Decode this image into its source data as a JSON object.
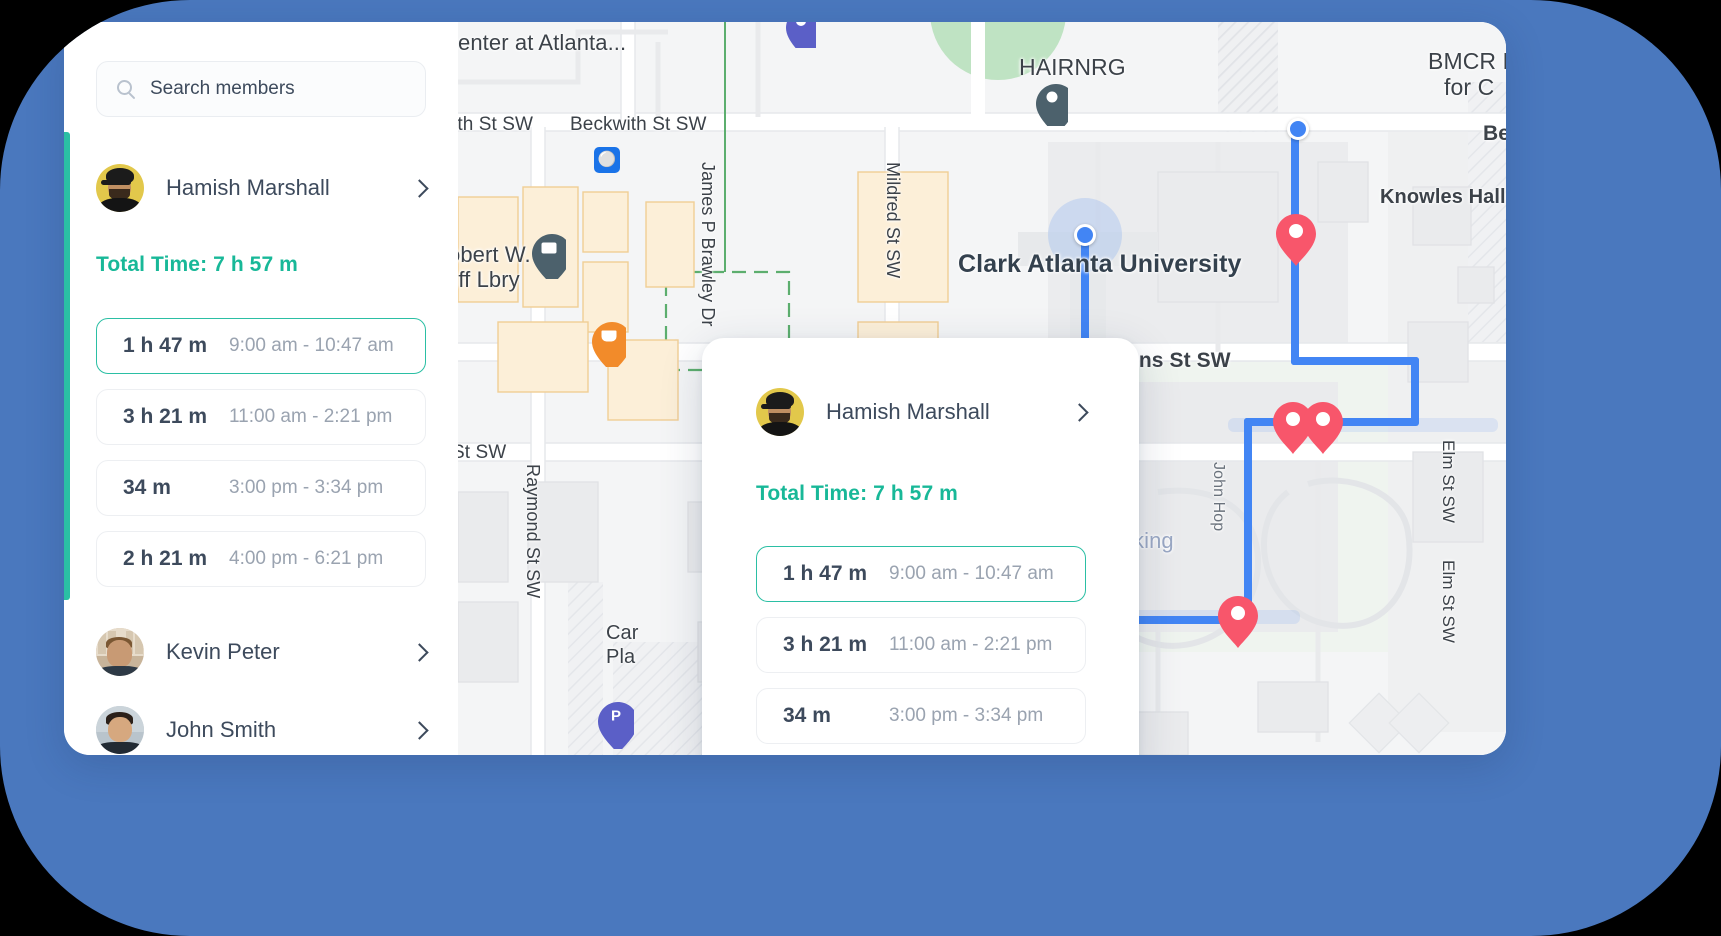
{
  "theme": {
    "frame_blue": "#4A78BE",
    "accent_teal": "#2BBFA4",
    "total_time_green": "#18B898",
    "text_dark": "#3D4A5C",
    "text_muted": "#9AA3B0",
    "route_blue": "#4285F4",
    "pin_red": "#F8566B",
    "pin_dark": "#4C616C",
    "pin_orange": "#F28B2A",
    "pin_purple": "#5B5FC7"
  },
  "search": {
    "placeholder": "Search members",
    "icon": "search-icon",
    "value": ""
  },
  "sidebar": {
    "selected_member": {
      "name": "Hamish Marshall",
      "avatar": "hamish-avatar",
      "chevron": "chevron-right-icon",
      "total_time_label": "Total Time: 7 h 57 m",
      "sessions": [
        {
          "duration": "1 h 47 m",
          "range": "9:00 am - 10:47 am",
          "selected": true
        },
        {
          "duration": "3 h 21 m",
          "range": "11:00 am - 2:21 pm",
          "selected": false
        },
        {
          "duration": "34 m",
          "range": "3:00 pm - 3:34 pm",
          "selected": false
        },
        {
          "duration": "2 h 21 m",
          "range": "4:00 pm - 6:21 pm",
          "selected": false
        }
      ]
    },
    "other_members": [
      {
        "name": "Kevin Peter",
        "avatar": "kevin-avatar",
        "chevron": "chevron-right-icon"
      },
      {
        "name": "John Smith",
        "avatar": "john-avatar",
        "chevron": "chevron-right-icon"
      }
    ]
  },
  "popup": {
    "member": {
      "name": "Hamish Marshall",
      "avatar": "hamish-avatar",
      "chevron": "chevron-right-icon"
    },
    "total_time_label": "Total Time: 7 h 57 m",
    "sessions": [
      {
        "duration": "1 h 47 m",
        "range": "9:00 am - 10:47 am",
        "selected": true
      },
      {
        "duration": "3 h 21 m",
        "range": "11:00 am - 2:21 pm",
        "selected": false
      },
      {
        "duration": "34 m",
        "range": "3:00 pm - 3:34 pm",
        "selected": false
      }
    ]
  },
  "map": {
    "labels": [
      {
        "text": "enter at Atlanta...",
        "kind": "poi"
      },
      {
        "text": "ith St SW",
        "kind": "street"
      },
      {
        "text": "Beckwith St SW",
        "kind": "street"
      },
      {
        "text": "James P Brawley Dr",
        "kind": "street-vertical"
      },
      {
        "text": "Mildred St SW",
        "kind": "street-vertical"
      },
      {
        "text": "HAIRNRG",
        "kind": "poi"
      },
      {
        "text": "BMCR B",
        "kind": "poi"
      },
      {
        "text": "for C",
        "kind": "poi"
      },
      {
        "text": "Be",
        "kind": "street"
      },
      {
        "text": "Knowles Hall",
        "kind": "poi"
      },
      {
        "text": "Clark Atlanta University",
        "kind": "place"
      },
      {
        "text": "obert W.",
        "kind": "poi"
      },
      {
        "text": "uff Lbry",
        "kind": "poi"
      },
      {
        "text": "Parsons St SW",
        "kind": "street"
      },
      {
        "text": "St SW",
        "kind": "street"
      },
      {
        "text": "Raymond St SW",
        "kind": "street-vertical"
      },
      {
        "text": "Car",
        "kind": "poi"
      },
      {
        "text": "Pla",
        "kind": "poi"
      },
      {
        "text": "king",
        "kind": "poi"
      },
      {
        "text": "Elm St SW",
        "kind": "street-vertical"
      },
      {
        "text": "Elm St SW",
        "kind": "street-vertical"
      },
      {
        "text": "John Hop",
        "kind": "street-vertical"
      }
    ],
    "markers": [
      {
        "name": "library-pin",
        "color": "#4C616C",
        "glyph": "book"
      },
      {
        "name": "hairnrg-pin",
        "color": "#4C616C",
        "glyph": "dot"
      },
      {
        "name": "cafe-pin",
        "color": "#F28B2A",
        "glyph": "cup"
      },
      {
        "name": "purple-pin",
        "color": "#5B5FC7",
        "glyph": "dot"
      },
      {
        "name": "parking-pin",
        "color": "#5B5FC7",
        "glyph": "P"
      },
      {
        "name": "bike-station-icon",
        "color": "#1A73E8",
        "glyph": "bike"
      },
      {
        "name": "stop-pin-1",
        "color": "#F8566B",
        "glyph": "hole"
      },
      {
        "name": "stop-pin-2",
        "color": "#F8566B",
        "glyph": "hole"
      },
      {
        "name": "stop-pin-3",
        "color": "#F8566B",
        "glyph": "hole"
      },
      {
        "name": "stop-pin-4",
        "color": "#F8566B",
        "glyph": "hole"
      }
    ],
    "route_color": "#4285F4",
    "current_location_marker": "current-location-dot"
  }
}
